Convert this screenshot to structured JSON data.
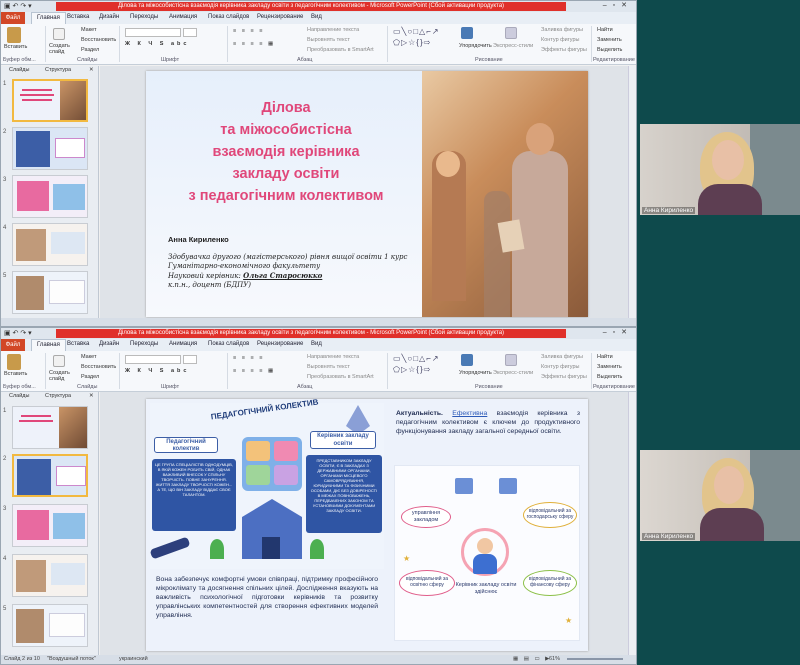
{
  "app": {
    "title": "Ділова та міжособистісна взаємодія керівника закладу освіти з педагогічним колективом - Microsoft PowerPoint (Сбой активации продукта)",
    "file_tab": "Файл",
    "tabs": [
      "Главная",
      "Вставка",
      "Дизайн",
      "Переходы",
      "Анимация",
      "Показ слайдов",
      "Рецензирование",
      "Вид"
    ]
  },
  "ribbon": {
    "paste": "Вставить",
    "create_slide": "Создать слайд",
    "layout": "Макет",
    "reset": "Восстановить",
    "section": "Раздел",
    "text_direction": "Направление текста",
    "align_text": "Выровнять текст",
    "smartart": "Преобразовать в SmartArt",
    "arrange": "Упорядочить",
    "quick_styles": "Экспресс-стили",
    "fill": "Заливка фигуры",
    "outline": "Контур фигуры",
    "effects": "Эффекты фигуры",
    "find": "Найти",
    "replace": "Заменить",
    "select": "Выделить",
    "group_clipboard": "Буфер обм...",
    "group_slides": "Слайды",
    "group_font": "Шрифт",
    "group_paragraph": "Абзац",
    "group_drawing": "Рисование",
    "group_editing": "Редактирование"
  },
  "pane": {
    "slides_tab": "Слайды",
    "outline_tab": "Структура"
  },
  "window1": {
    "slide": {
      "title": "Ділова\nта міжособистісна\nвзаємодія керівника\nзакладу освіти\nз педагогічним колективом",
      "author": "Анна Кириленко",
      "line1": "Здобувачка другого (магістерського) рівня вищої освіти 1 курс",
      "line2": "Гуманітарно-економічного факультету",
      "line3_label": "Науковий керівник: ",
      "line3_name": "Ольга Старосюкко",
      "line4": "к.п.н., доцент (БДПУ)"
    },
    "thumb_numbers": [
      "1",
      "2",
      "3",
      "4",
      "5"
    ]
  },
  "window2": {
    "left_panel": {
      "banner": "ПЕДАГОГІЧНИЙ КОЛЕКТИВ",
      "badge_left": "Педагогічний колектив",
      "badge_right": "Керівник закладу освіти",
      "text_left": "ЦЕ ГРУПА СПЕЦІАЛІСТІВ ОДНОДУМЦІВ, В ЯКІЙ КОЖЕН РОБИТЬ СВІЙ, ОДНАК ВАЖЛИВИЙ ВНЕСОК У СПІЛЬНУ ТВОРЧІСТЬ. ПОВНЕ ЗАНУРЕННЯ. ЖИТТЯ ЗАКЛАДУ ТВОРЧОСТІ КОЖЕН... А ТЕ, ЩО ВІН ЗАКЛАДУ ВІДДАЄ СВОЄ ТАЛАНТОМ.",
      "text_right": "ПРЕДСТАВНИКОМ ЗАКЛАДУ ОСВІТИ, Є В ЗАКЛАДАХ З ДЕРЖАВНИМИ ОРГАНАМИ, ОРГАНАМИ МІСЦЕВОГО САМОВРЯДУВАННЯ, ЮРИДИЧНИМИ ТА ФІЗИЧНИМИ ОСОБАМИ, ДІЄ БЕЗ ДОВІРЕНОСТІ В МЕЖАХ ПОВНОВАЖЕНЬ, ПЕРЕДБАЧЕНИХ ЗАКОНОМ ТА УСТАНОВЧИМИ ДОКУМЕНТАМИ ЗАКЛАДУ ОСВІТИ.",
      "body": "Вона забезпечує комфортні умови співпраці, підтримку професійного мікроклімату та досягнення спільних цілей. Дослідження вказують на важливість психологічної підготовки керівників та розвитку управлінських компетентностей для створення ефективних моделей управління."
    },
    "right_panel": {
      "heading_label": "Актуальність.",
      "heading_link": "Ефективна",
      "heading_rest": "взаємодія керівника з педагогічним колективом є ключем до продуктивного функціонування закладу загальної середньої освіти.",
      "bubble_top_left": "управління закладом",
      "bubble_top_right": "відповідальний за господарську сферу",
      "bubble_bottom_left": "відповідальний за освітню сферу",
      "bubble_bottom_right": "відповідальний за фінансову сферу",
      "center_caption": "Керівник закладу освіти здійснює"
    },
    "thumb_numbers": [
      "1",
      "2",
      "3",
      "4",
      "5"
    ]
  },
  "status": {
    "slide_of": "Слайд 2 из 10",
    "theme": "\"Воздушный поток\"",
    "lang": "украинский",
    "zoom": "61%"
  },
  "video": {
    "name": "Анна Кириленко"
  },
  "colors": {
    "title_pink": "#e0477a",
    "pp_orange": "#d24726",
    "desk_teal": "#0e4a4c"
  }
}
